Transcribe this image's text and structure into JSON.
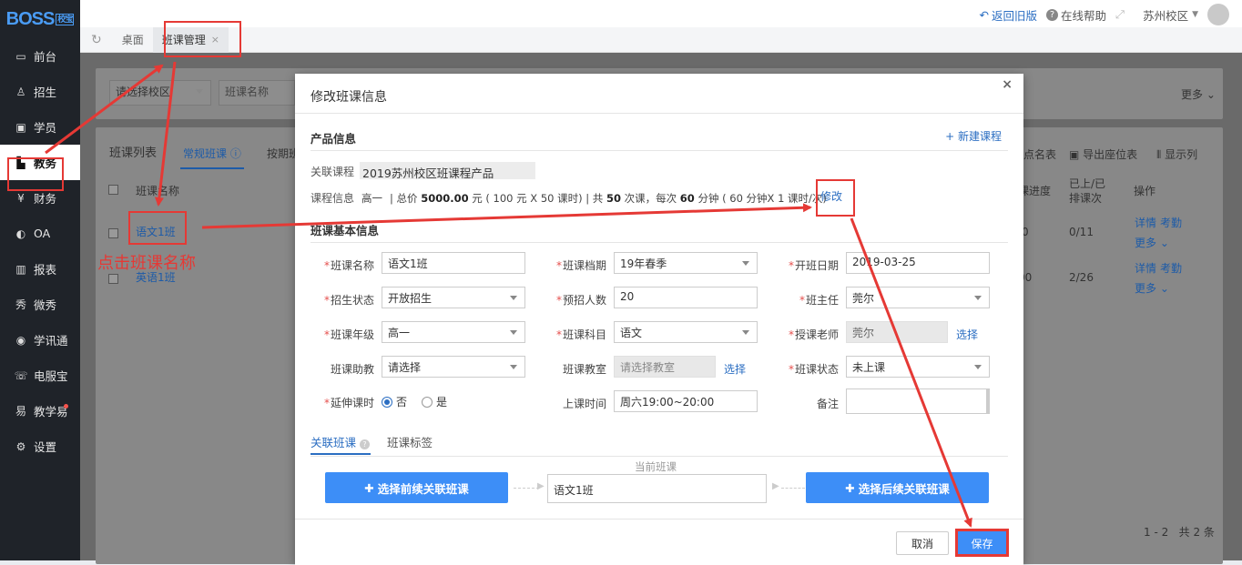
{
  "app": {
    "logo": "BOSS",
    "logo_badge": "校宝"
  },
  "sidebar": {
    "items": [
      {
        "label": "前台",
        "icon": "monitor-icon"
      },
      {
        "label": "招生",
        "icon": "user-plus-icon"
      },
      {
        "label": "学员",
        "icon": "student-icon"
      },
      {
        "label": "教务",
        "icon": "book-icon",
        "active": true
      },
      {
        "label": "财务",
        "icon": "yen-icon"
      },
      {
        "label": "OA",
        "icon": "toggle-icon"
      },
      {
        "label": "报表",
        "icon": "bar-chart-icon"
      },
      {
        "label": "微秀",
        "icon": "weixiu-icon"
      },
      {
        "label": "学讯通",
        "icon": "location-icon"
      },
      {
        "label": "电服宝",
        "icon": "phone-icon"
      },
      {
        "label": "教学易",
        "icon": "teach-icon",
        "badge": true
      },
      {
        "label": "设置",
        "icon": "gear-icon"
      }
    ]
  },
  "topbar": {
    "back": "返回旧版",
    "help": "在线帮助",
    "campus": "苏州校区"
  },
  "tabs": {
    "home": "桌面",
    "current": "班课管理",
    "close": "×"
  },
  "background": {
    "campus_select": "请选择校区",
    "class_name_ph": "班课名称",
    "more": "更多",
    "list_title": "班课列表",
    "tab_regular": "常规班课",
    "tab_other": "按期班",
    "roll_call": "点名表",
    "export_seat": "导出座位表",
    "show_cols": "显示列",
    "col_name": "班课名称",
    "col_progress": "课进度",
    "col_done": "已上/已排课次",
    "col_ops": "操作",
    "rows": [
      {
        "name": "语文1班",
        "progress": "0",
        "done": "0/11",
        "detail": "详情",
        "attend": "考勤",
        "more": "更多"
      },
      {
        "name": "英语1班",
        "progress": "00",
        "done": "2/26",
        "detail": "详情",
        "attend": "考勤",
        "more": "更多"
      }
    ],
    "pagination": "1 - 2   共 2 条"
  },
  "modal": {
    "title": "修改班课信息",
    "close": "×",
    "product_section": "产品信息",
    "new_course": "+ 新建课程",
    "linked_course_label": "关联课程",
    "linked_course": "2019苏州校区班课程产品",
    "course_info_label": "课程信息",
    "course_grade": "高一",
    "course_info_pre": "| 总价 ",
    "course_total": "5000.00",
    "course_info_mid": " 元 ( 100 元 X 50 课时) | 共 ",
    "course_times": "50",
    "course_info_mid2": " 次课，每次 ",
    "course_minutes": "60",
    "course_info_post": " 分钟 ( 60 分钟X 1 课时/次)",
    "modify": "修改",
    "basic_section": "班课基本信息",
    "fields": {
      "class_name": {
        "label": "班课名称",
        "value": "语文1班"
      },
      "term": {
        "label": "班课档期",
        "value": "19年春季"
      },
      "start_date": {
        "label": "开班日期",
        "value": "2019-03-25"
      },
      "enroll_status": {
        "label": "招生状态",
        "value": "开放招生"
      },
      "expected": {
        "label": "预招人数",
        "value": "20"
      },
      "head_teacher": {
        "label": "班主任",
        "value": "莞尔"
      },
      "grade": {
        "label": "班课年级",
        "value": "高一"
      },
      "subject": {
        "label": "班课科目",
        "value": "语文"
      },
      "teacher": {
        "label": "授课老师",
        "value": "莞尔",
        "action": "选择"
      },
      "assistant": {
        "label": "班课助教",
        "value": "请选择"
      },
      "classroom": {
        "label": "班课教室",
        "placeholder": "请选择教室",
        "action": "选择"
      },
      "status": {
        "label": "班课状态",
        "value": "未上课"
      },
      "extend": {
        "label": "延伸课时",
        "opt_no": "否",
        "opt_yes": "是",
        "selected": "否"
      },
      "time": {
        "label": "上课时间",
        "value": "周六19:00~20:00"
      },
      "remark": {
        "label": "备注",
        "value": ""
      }
    },
    "subtabs": {
      "linked": "关联班课",
      "tags": "班课标签"
    },
    "current_class_label": "当前班课",
    "current_class": "语文1班",
    "btn_prev": "选择前续关联班课",
    "btn_next": "选择后续关联班课",
    "cancel": "取消",
    "save": "保存"
  },
  "annotation": {
    "text": "点击班课名称"
  },
  "colors": {
    "accent": "#3d8ef7",
    "link": "#2b6ec2",
    "highlight": "#e53935",
    "sidebar": "#1f2329"
  }
}
